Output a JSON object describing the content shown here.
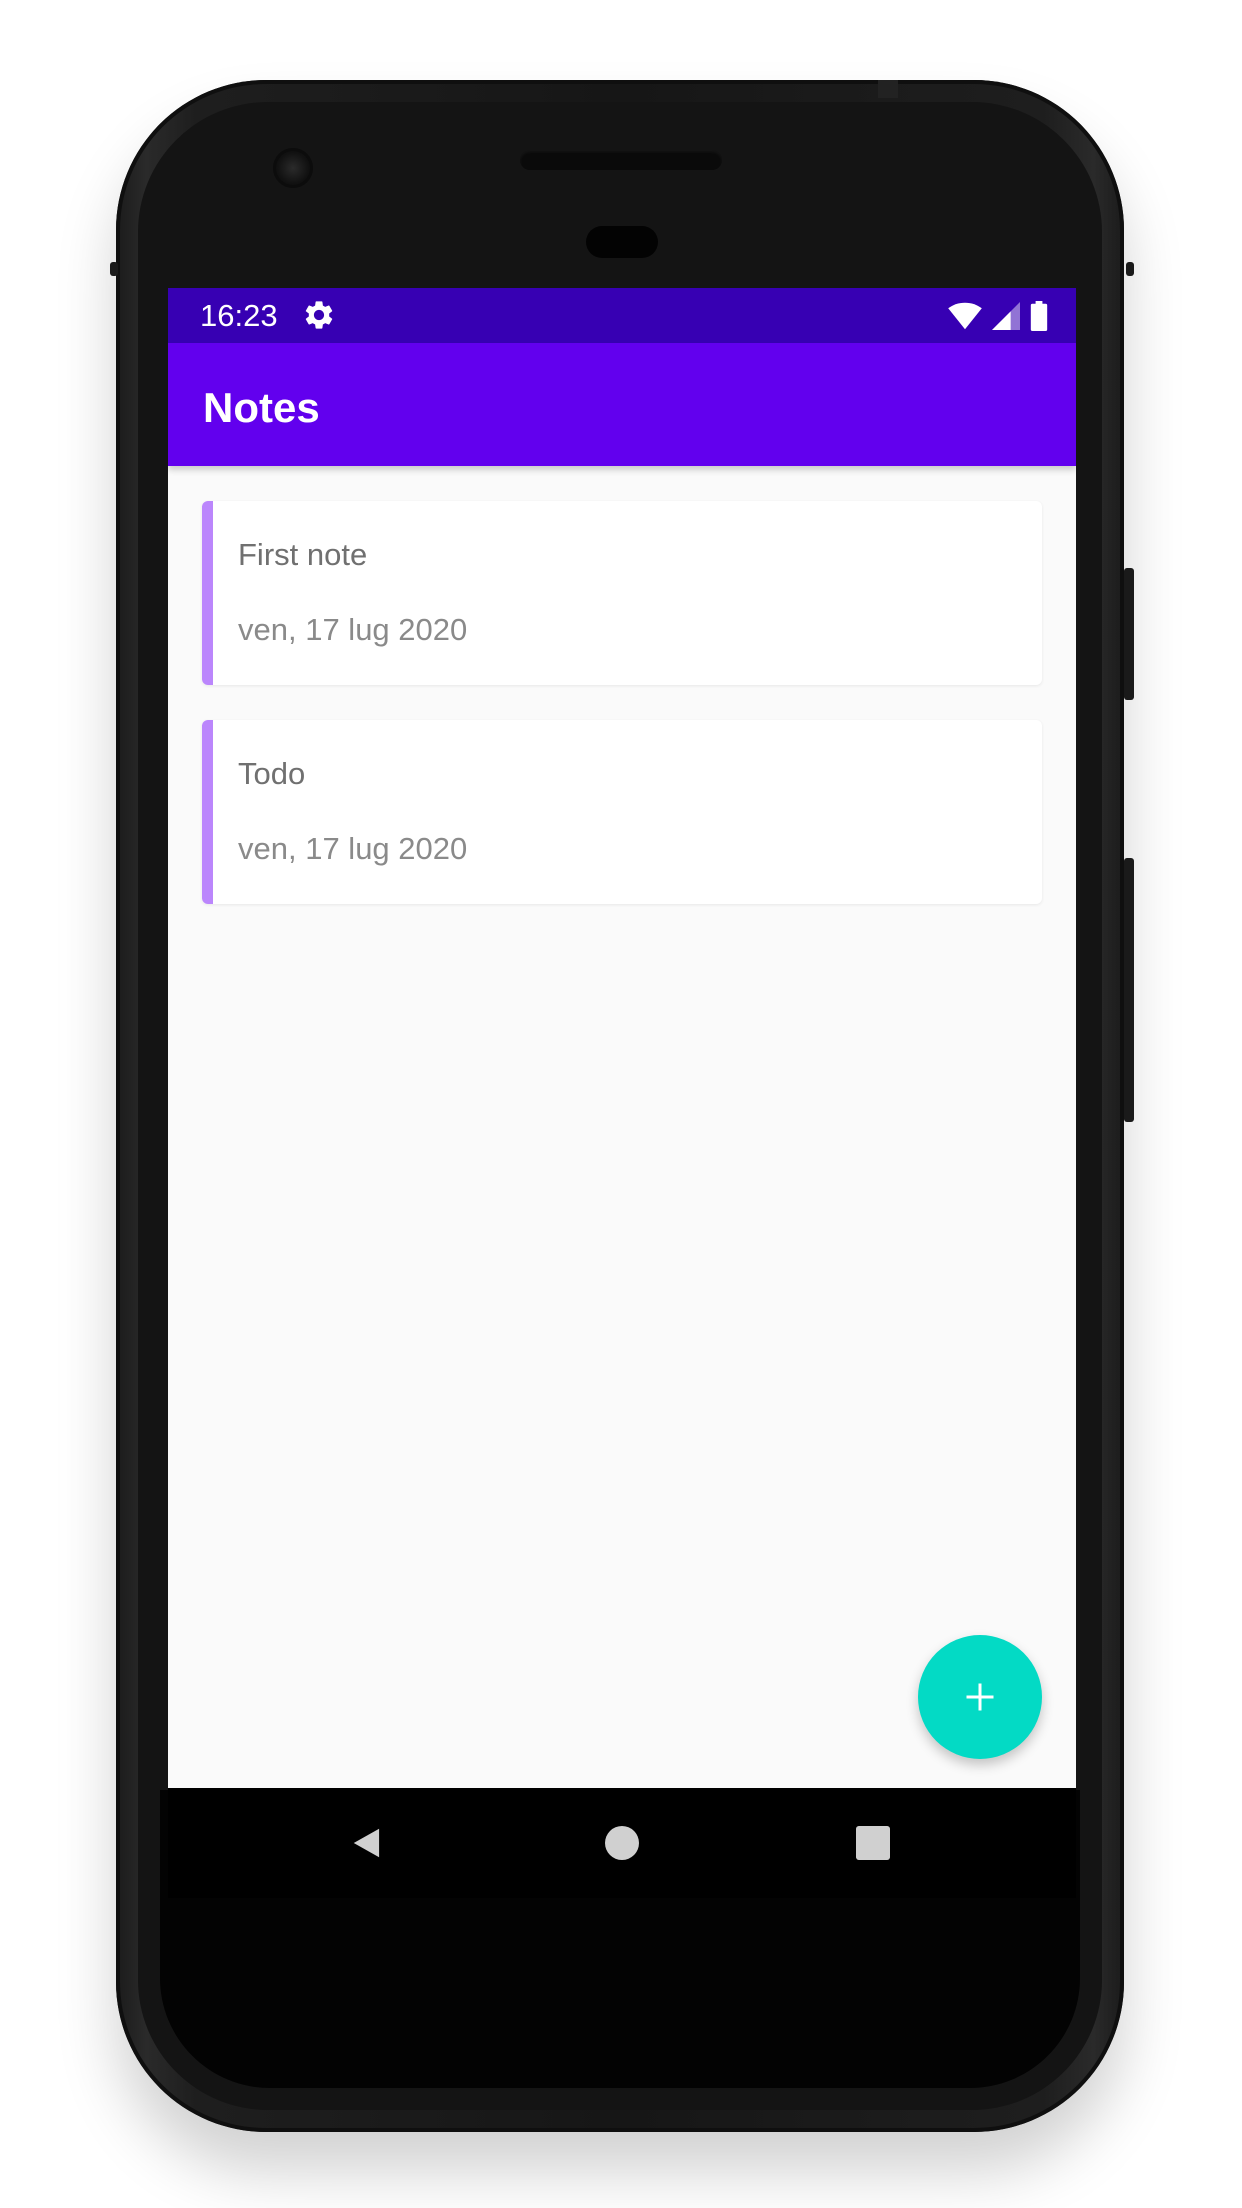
{
  "status_bar": {
    "time": "16:23",
    "icons": [
      "gear-icon",
      "wifi-icon",
      "signal-icon",
      "battery-icon"
    ]
  },
  "app_bar": {
    "title": "Notes"
  },
  "notes": [
    {
      "title": "First note",
      "date": "ven, 17 lug 2020"
    },
    {
      "title": "Todo",
      "date": "ven, 17 lug 2020"
    }
  ],
  "fab": {
    "icon": "plus-icon"
  },
  "nav_bar": {
    "buttons": [
      "back-icon",
      "home-icon",
      "recents-icon"
    ]
  },
  "colors": {
    "status_bar": "#3700b3",
    "app_bar": "#6200ee",
    "accent": "#bb86fc",
    "fab": "#03dac5",
    "background": "#fafafa"
  }
}
